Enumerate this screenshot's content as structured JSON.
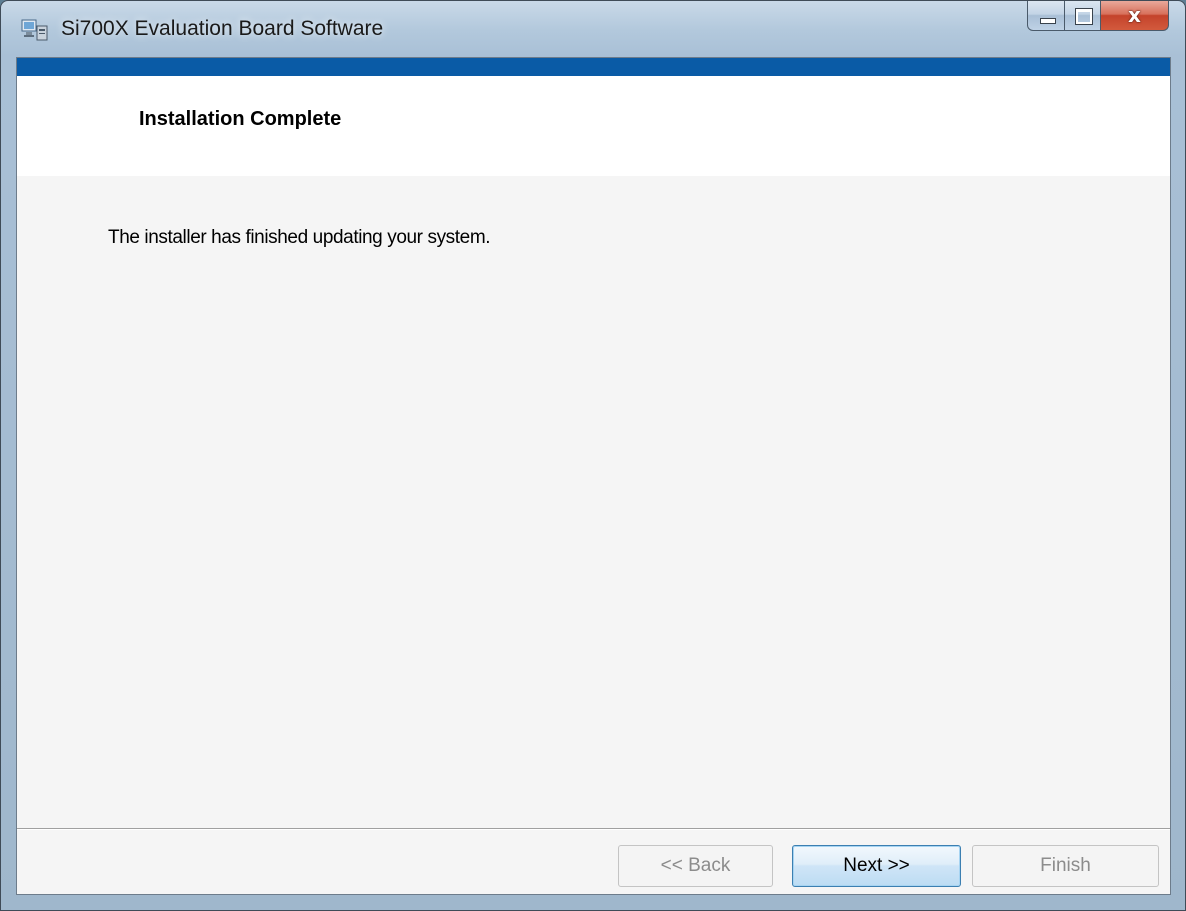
{
  "window": {
    "title": "Si700X Evaluation Board Software",
    "icon": "installer-computer-icon",
    "caption_buttons": {
      "minimize_icon": "minimize-icon",
      "maximize_icon": "maximize-icon",
      "close_glyph": "x",
      "close_icon": "close-icon"
    }
  },
  "banner": {
    "title": "Installation Complete",
    "accent_color": "#0a5ba6"
  },
  "body": {
    "message": "The installer has finished updating your system."
  },
  "buttons": {
    "back": {
      "label": "<< Back",
      "enabled": false
    },
    "next": {
      "label": "Next >>",
      "enabled": true
    },
    "finish": {
      "label": "Finish",
      "enabled": false
    }
  }
}
